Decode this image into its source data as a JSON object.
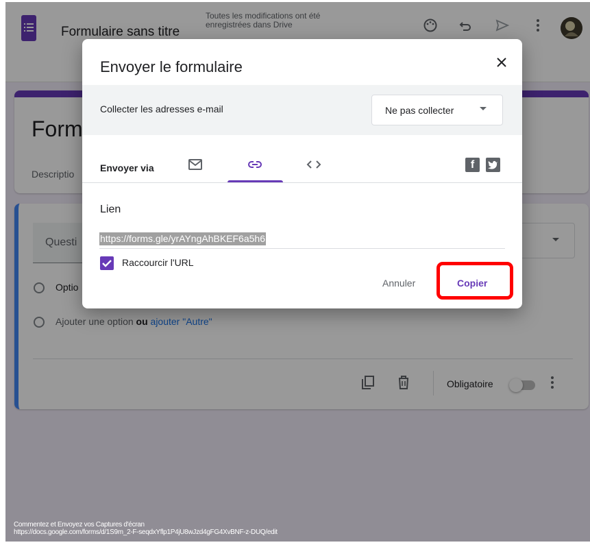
{
  "topbar": {
    "doc_title": "Formulaire sans titre",
    "save_status": "Toutes les modifications ont été enregistrées dans Drive"
  },
  "background_form": {
    "title": "Form",
    "description": "Descriptio",
    "question_placeholder": "Questi",
    "option1": "Optio",
    "add_option": "Ajouter une option",
    "or_word": "ou",
    "add_other": "ajouter \"Autre\"",
    "required_label": "Obligatoire"
  },
  "dialog": {
    "title": "Envoyer le formulaire",
    "collect_label": "Collecter les adresses e-mail",
    "collect_value": "Ne pas collecter",
    "send_via_label": "Envoyer via",
    "tabs": [
      "email",
      "link",
      "embed"
    ],
    "active_tab": "link",
    "link_heading": "Lien",
    "link_url": "https://forms.gle/yrAYngAhBKEF6a5h6",
    "shorten_label": "Raccourcir l'URL",
    "shorten_checked": true,
    "cancel_label": "Annuler",
    "copy_label": "Copier"
  },
  "caption": {
    "line1": "Commentez et Envoyez vos Captures d'écran",
    "line2": "https://docs.google.com/forms/d/1S9m_2-F-seqdxYflp1P4jU8wJzd4gFG4XvBNF-z-DUQ/edit"
  },
  "colors": {
    "brand": "#673ab7",
    "highlight": "#ff0000",
    "link": "#1a73e8"
  }
}
